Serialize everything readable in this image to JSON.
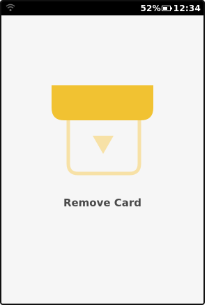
{
  "status_bar": {
    "battery_percent": "52%",
    "time": "12:34",
    "icons": [
      "wifi-icon",
      "battery-icon"
    ]
  },
  "illustration": {
    "name": "card-reader-remove-card",
    "reader_color": "#f1c232",
    "card_color": "#f7e1a6",
    "arrow_direction": "down"
  },
  "message": {
    "text": "Remove Card"
  }
}
